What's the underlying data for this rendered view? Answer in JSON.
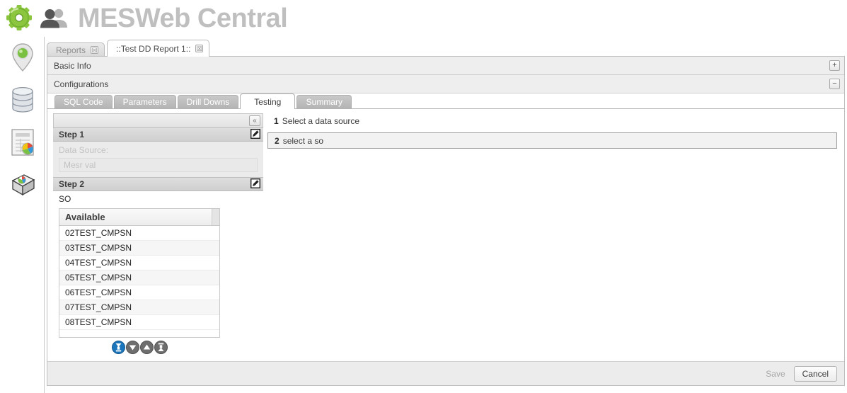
{
  "header": {
    "title": "MESWeb Central",
    "gear_icon": "gear-icon",
    "users_icon": "users-icon"
  },
  "rail": {
    "items": [
      {
        "icon": "location-pin-icon",
        "name": "rail-item-location"
      },
      {
        "icon": "database-icon",
        "name": "rail-item-database"
      },
      {
        "icon": "report-chart-icon",
        "name": "rail-item-report"
      },
      {
        "icon": "report-stack-icon",
        "name": "rail-item-report-stack"
      }
    ]
  },
  "doc_tabs": [
    {
      "label": "Reports",
      "active": false,
      "close": "☒"
    },
    {
      "label": "::Test DD Report 1::",
      "active": true,
      "close": "☒"
    }
  ],
  "sections": {
    "basic_info": {
      "title": "Basic Info",
      "toggle": "+"
    },
    "configurations": {
      "title": "Configurations",
      "toggle": "−"
    }
  },
  "subtabs": [
    {
      "label": "SQL Code",
      "active": false
    },
    {
      "label": "Parameters",
      "active": false
    },
    {
      "label": "Drill Downs",
      "active": false
    },
    {
      "label": "Testing",
      "active": true
    },
    {
      "label": "Summary",
      "active": false
    }
  ],
  "left_panel": {
    "collapse_label": "«",
    "step1": {
      "title": "Step 1",
      "edit_icon": "edit-pencil-icon",
      "data_source_label": "Data Source:",
      "data_source_value": "Mesr val"
    },
    "step2": {
      "title": "Step 2",
      "edit_icon": "edit-pencil-icon",
      "value": "SO"
    },
    "available": {
      "header": "Available",
      "rows": [
        "02TEST_CMPSN",
        "03TEST_CMPSN",
        "04TEST_CMPSN",
        "05TEST_CMPSN",
        "06TEST_CMPSN",
        "07TEST_CMPSN",
        "08TEST_CMPSN"
      ]
    },
    "arrows": [
      {
        "name": "move-bottom-button",
        "glyph": "bottom",
        "active": true
      },
      {
        "name": "move-down-button",
        "glyph": "down",
        "active": false
      },
      {
        "name": "move-up-button",
        "glyph": "up",
        "active": false
      },
      {
        "name": "move-top-button",
        "glyph": "top",
        "active": false
      }
    ]
  },
  "right_panel": {
    "steps": [
      {
        "num": "1",
        "label": "Select a data source",
        "selected": false
      },
      {
        "num": "2",
        "label": "select a so",
        "selected": true
      }
    ]
  },
  "footer": {
    "save_label": "Save",
    "cancel_label": "Cancel"
  },
  "colors": {
    "accent_blue": "#1b75bb",
    "grey_button": "#6e6e6e",
    "title_grey": "#bfbfbf",
    "green_gear": "#7ac143"
  }
}
